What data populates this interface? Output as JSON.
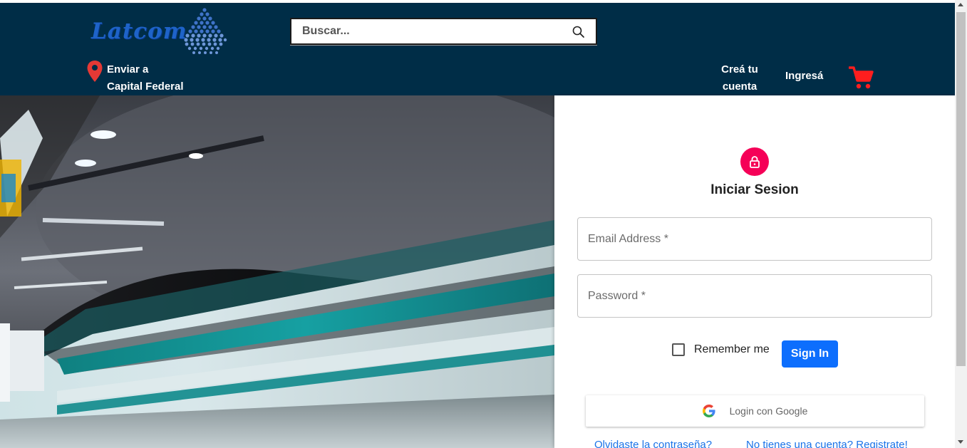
{
  "header": {
    "logo_text": "Latcom",
    "search": {
      "placeholder": "Buscar...",
      "icon": "search-icon"
    },
    "ship_to": {
      "line1": "Enviar a",
      "line2": "Capital Federal",
      "icon": "location-pin-icon"
    },
    "nav": {
      "create_account_line1": "Creá tu",
      "create_account_line2": "cuenta",
      "login": "Ingresá",
      "cart_icon": "cart-icon"
    },
    "colors": {
      "background": "#002d47",
      "pin": "#e53935",
      "cart": "#ff1e1e"
    }
  },
  "hero": {
    "description_icon": "subway-train-photo"
  },
  "login": {
    "title": "Iniciar Sesion",
    "icon": "lock-icon",
    "email_placeholder": "Email Address *",
    "password_placeholder": "Password *",
    "remember_label": "Remember me",
    "remember_checked": false,
    "signin_label": "Sign In",
    "google_label": "Login con Google",
    "forgot_link": "Olvidaste la contraseña?",
    "register_link": "No tienes una cuenta? Registrate!",
    "colors": {
      "accent": "#f50057",
      "button": "#0d6efd",
      "link": "#1a73e8"
    }
  }
}
